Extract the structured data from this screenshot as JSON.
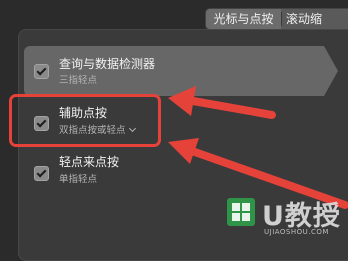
{
  "tabs": [
    {
      "label": "光标与点按"
    },
    {
      "label": "滚动缩"
    }
  ],
  "options": [
    {
      "title": "查询与数据检测器",
      "subtitle": "三指轻点",
      "checked": true
    },
    {
      "title": "辅助点按",
      "subtitle": "双指点按或轻点",
      "checked": true
    },
    {
      "title": "轻点来点按",
      "subtitle": "单指轻点",
      "checked": true
    }
  ],
  "watermark": {
    "brand": "U教授",
    "url": "UJIAOSHOU.COM"
  },
  "colors": {
    "highlight": "#e5423a",
    "selected_row": "#676767",
    "panel": "#3a3a3a"
  }
}
